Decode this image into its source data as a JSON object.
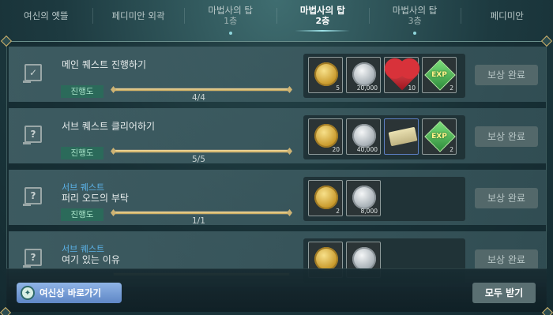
{
  "tabs": [
    {
      "label": "여신의 옛뜰",
      "sub": "",
      "active": false
    },
    {
      "label": "페디미안 외곽",
      "sub": "",
      "active": false
    },
    {
      "label": "마법사의 탑",
      "sub": "1층",
      "active": false
    },
    {
      "label": "마법사의 탑",
      "sub": "2층",
      "active": true
    },
    {
      "label": "마법사의 탑",
      "sub": "3층",
      "active": false
    },
    {
      "label": "페디미안",
      "sub": "",
      "active": false
    }
  ],
  "quests": [
    {
      "type": "",
      "title": "메인 퀘스트 진행하기",
      "status": "진행도",
      "progress": 1.0,
      "count": "4/4",
      "icon": "check-icon",
      "rewards": [
        {
          "kind": "gold-coin-icon",
          "qty": "5"
        },
        {
          "kind": "silver-coin-icon",
          "qty": "20,000"
        },
        {
          "kind": "heart-icon",
          "qty": "10"
        },
        {
          "kind": "exp-icon",
          "qty": "2"
        }
      ],
      "claim": "보상 완료"
    },
    {
      "type": "",
      "title": "서브 퀘스트 클리어하기",
      "status": "진행도",
      "progress": 1.0,
      "count": "5/5",
      "icon": "question-scroll-icon",
      "rewards": [
        {
          "kind": "gold-coin-icon",
          "qty": "20"
        },
        {
          "kind": "silver-coin-icon",
          "qty": "40,000"
        },
        {
          "kind": "scroll-icon",
          "qty": ""
        },
        {
          "kind": "exp-icon",
          "qty": "2"
        }
      ],
      "claim": "보상 완료"
    },
    {
      "type": "서브 퀘스트",
      "title": "퍼리 오드의 부탁",
      "status": "진행도",
      "progress": 1.0,
      "count": "1/1",
      "icon": "question-scroll-icon",
      "rewards": [
        {
          "kind": "gold-coin-icon",
          "qty": "2"
        },
        {
          "kind": "silver-coin-icon",
          "qty": "8,000"
        }
      ],
      "claim": "보상 완료"
    },
    {
      "type": "서브 퀘스트",
      "title": "여기 있는 이유",
      "status": "",
      "progress": 1.0,
      "count": "",
      "icon": "question-scroll-icon",
      "rewards": [
        {
          "kind": "gold-coin-icon",
          "qty": ""
        },
        {
          "kind": "silver-coin-icon",
          "qty": ""
        }
      ],
      "claim": "보상 완료"
    }
  ],
  "bottom": {
    "shortcut_label": "여신상 바로가기",
    "claim_all_label": "모두 받기"
  },
  "colors": {
    "accent_blue": "#5bb2e8",
    "badge_green": "#2b6a5a",
    "progress_gold": "#e6c77a"
  }
}
